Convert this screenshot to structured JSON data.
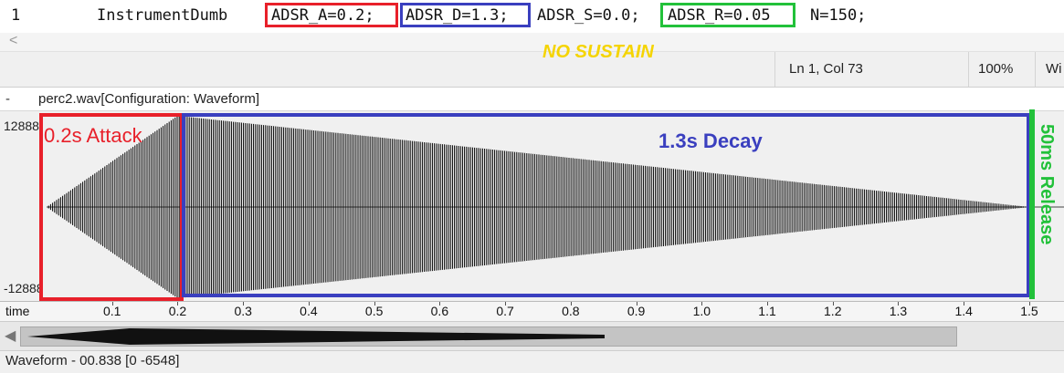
{
  "editor": {
    "line_number": "1",
    "instrument": "InstrumentDumb",
    "adsr_a": "ADSR_A=0.2;",
    "adsr_d": "ADSR_D=1.3;",
    "adsr_s": "ADSR_S=0.0;",
    "adsr_r": "ADSR_R=0.05",
    "n_param": "N=150;"
  },
  "scrollbar": {
    "left_arrow": "<"
  },
  "status_bar": {
    "position": "Ln 1, Col 73",
    "zoom": "100%",
    "extra": "Wi"
  },
  "annotations": {
    "no_sustain": "NO SUSTAIN",
    "attack": "0.2s Attack",
    "decay": "1.3s Decay",
    "release": "50ms Release",
    "attack_color": "#e8202a",
    "decay_color": "#3a3fbf",
    "release_color": "#22c13a",
    "no_sustain_color": "#f5d400"
  },
  "waveform_panel": {
    "collapse_marker": "-",
    "title": "perc2.wav[Configuration: Waveform]",
    "y_max_label": "12888",
    "y_min_label": "-12888",
    "time_axis_label": "time",
    "time_ticks": [
      "0.1",
      "0.2",
      "0.3",
      "0.4",
      "0.5",
      "0.6",
      "0.7",
      "0.8",
      "0.9",
      "1.0",
      "1.1",
      "1.2",
      "1.3",
      "1.4",
      "1.5"
    ],
    "overview_left_arrow": "◀"
  },
  "chart_data": {
    "type": "area",
    "x_label": "time",
    "x_range": [
      0,
      1.55
    ],
    "y_range": [
      -12888,
      12888
    ],
    "envelope": {
      "attack_seconds": 0.2,
      "decay_seconds": 1.3,
      "sustain_level": 0.0,
      "release_seconds": 0.05
    }
  },
  "footer": {
    "text": "Waveform - 00.838 [0 -6548]"
  }
}
